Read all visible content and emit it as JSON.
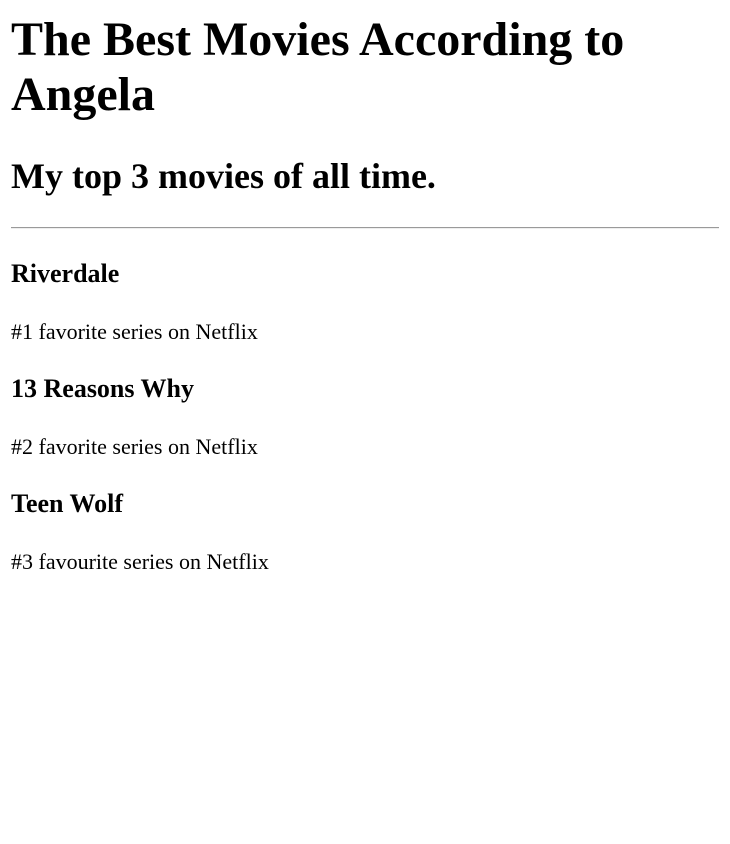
{
  "page": {
    "title": "The Best Movies According to Angela",
    "subtitle": "My top 3 movies of all time."
  },
  "movies": [
    {
      "name": "Riverdale",
      "description": "#1 favorite series on Netflix"
    },
    {
      "name": "13 Reasons Why",
      "description": "#2 favorite series on Netflix"
    },
    {
      "name": "Teen Wolf",
      "description": "#3 favourite series on Netflix"
    }
  ]
}
